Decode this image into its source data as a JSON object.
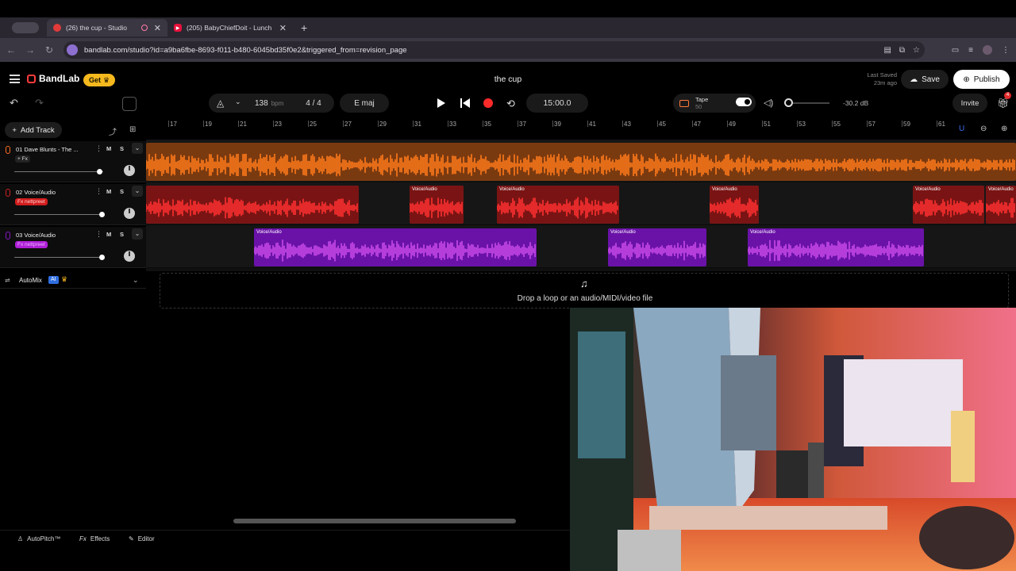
{
  "browser": {
    "tabs": [
      {
        "title": "(26) the cup - Studio",
        "favicon_color": "#e03a3a"
      },
      {
        "title": "(205) BabyChiefDoit - Lunch",
        "favicon_color": "#e8113c"
      }
    ],
    "url": "bandlab.com/studio?id=a9ba6fbe-8693-f011-b480-6045bd35f0e2&triggered_from=revision_page"
  },
  "header": {
    "brand": "BandLab",
    "get_label": "Get",
    "project_title": "the cup",
    "last_saved_line1": "Last Saved",
    "last_saved_line2": "23m ago",
    "save_label": "Save",
    "publish_label": "Publish"
  },
  "transport": {
    "bpm": "138",
    "bpm_unit": "bpm",
    "time_sig": "4 / 4",
    "key": "E maj",
    "time": "15:00.0",
    "tape_label": "Tape",
    "tape_value": "50",
    "volume_db": "-30.2 dB",
    "volume_level": 0.0,
    "invite_label": "Invite",
    "gift_badge": "4"
  },
  "tracks_panel": {
    "add_track_label": "Add Track",
    "tracks": [
      {
        "name": "01  Dave Blunts - The ...",
        "fx": "+ Fx",
        "fx_bg": "#222222",
        "fx_color": "#dddddd",
        "color": "#ff6a1a",
        "volume": 0.97
      },
      {
        "name": "02  Voice/Audio",
        "fx": "Fx nettpreet",
        "fx_bg": "#d11d1d",
        "fx_color": "#ffd0d0",
        "color": "#d42020",
        "volume": 1.0
      },
      {
        "name": "03  Voice/Audio",
        "fx": "Fx nettpreet",
        "fx_bg": "#b01ed6",
        "fx_color": "#e8b8ff",
        "color": "#8a16c8",
        "volume": 1.0
      }
    ],
    "m_label": "M",
    "s_label": "S",
    "automix_label": "AutoMix",
    "automix_ai": "AI"
  },
  "ruler": {
    "ticks": [
      "17",
      "19",
      "21",
      "23",
      "25",
      "27",
      "29",
      "31",
      "33",
      "35",
      "37",
      "39",
      "41",
      "43",
      "45",
      "47",
      "49",
      "51",
      "53",
      "55",
      "57",
      "59",
      "61"
    ]
  },
  "clip_label": "Voice/Audio",
  "dropzone_text": "Drop a loop or an audio/MIDI/video file",
  "bottom_bar": {
    "autopitch": "AutoPitch™",
    "effects": "Effects",
    "editor": "Editor"
  }
}
